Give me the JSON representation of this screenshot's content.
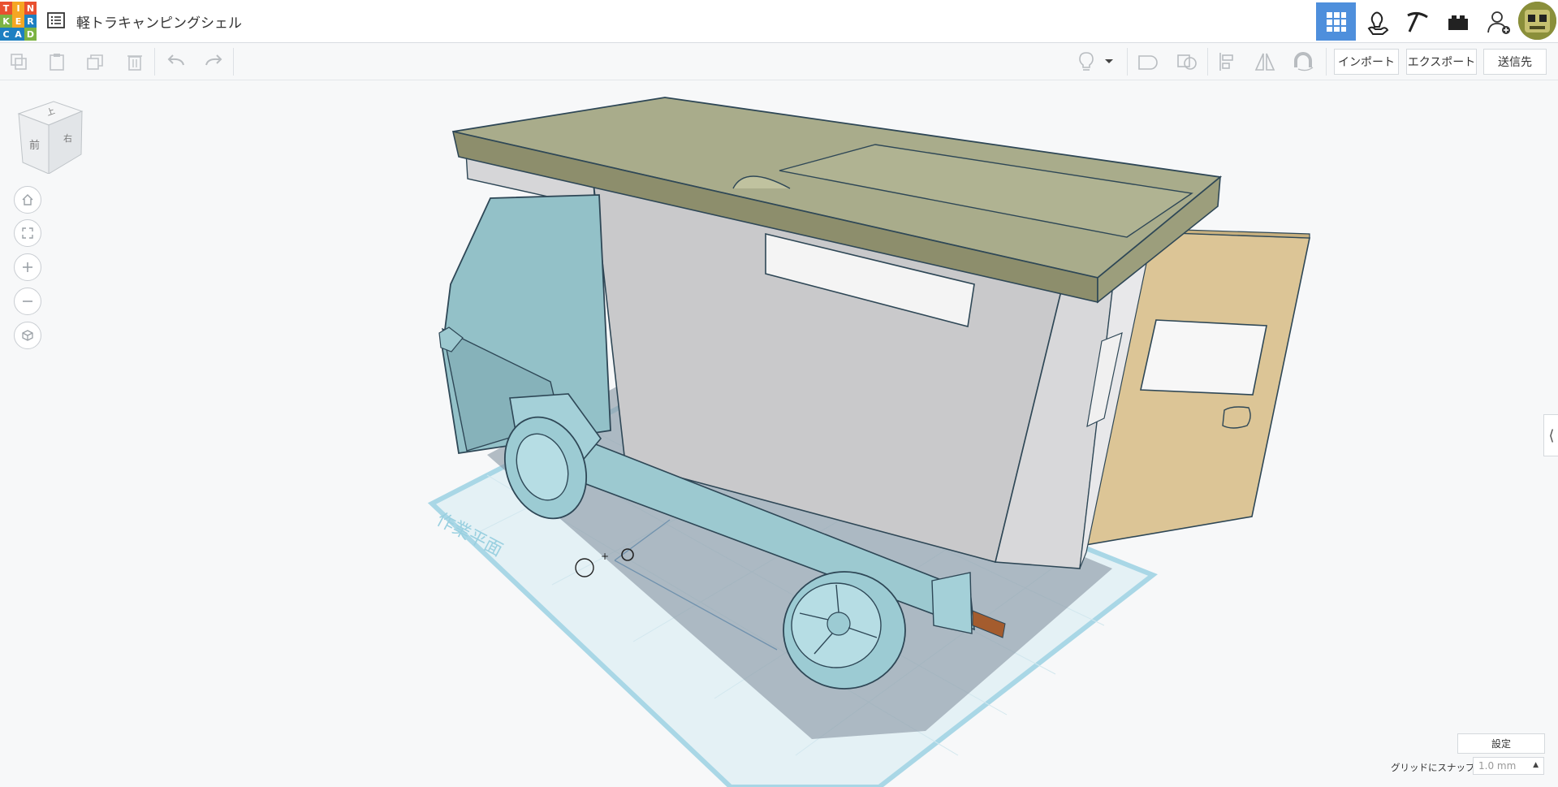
{
  "logo": {
    "letters": [
      "T",
      "I",
      "N",
      "K",
      "E",
      "R",
      "C",
      "A",
      "D"
    ],
    "colors": [
      "#e8502f",
      "#f5a623",
      "#e8502f",
      "#7cb342",
      "#f5a623",
      "#1d7fc1",
      "#1d7fc1",
      "#1d7fc1",
      "#7cb342"
    ]
  },
  "header": {
    "project_title": "軽トラキャンピングシェル"
  },
  "modes": [
    {
      "icon": "grid-icon",
      "active": true
    },
    {
      "icon": "bulb-hand-icon",
      "active": false
    },
    {
      "icon": "pickaxe-icon",
      "active": false
    },
    {
      "icon": "brick-icon",
      "active": false
    },
    {
      "icon": "add-user-icon",
      "active": false
    }
  ],
  "toolbar": {
    "left_icons": [
      "copy-icon",
      "paste-icon",
      "duplicate-icon",
      "delete-icon",
      "undo-icon",
      "redo-icon"
    ],
    "right_icons": [
      "light-bulb-icon",
      "dropdown-arrow-icon",
      "group-icon",
      "ungroup-icon",
      "align-icon",
      "mirror-icon",
      "magnet-icon"
    ],
    "import_label": "インポート",
    "export_label": "エクスポート",
    "send_label": "送信先"
  },
  "viewcube": {
    "front": "前",
    "right": "右",
    "top": "上"
  },
  "nav_icons": [
    "home-icon",
    "fit-view-icon",
    "zoom-in-icon",
    "zoom-out-icon",
    "perspective-icon"
  ],
  "workplane": {
    "label": "作業平面"
  },
  "bottom": {
    "settings_label": "設定",
    "snap_label": "グリッドにスナップ",
    "snap_value": "1.0 mm"
  },
  "colors": {
    "accent": "#4e8fdc",
    "shell_top": "#a9ac8b",
    "body": "#c9c9cb",
    "cab": "#93c1c8",
    "door": "#dcc596"
  }
}
